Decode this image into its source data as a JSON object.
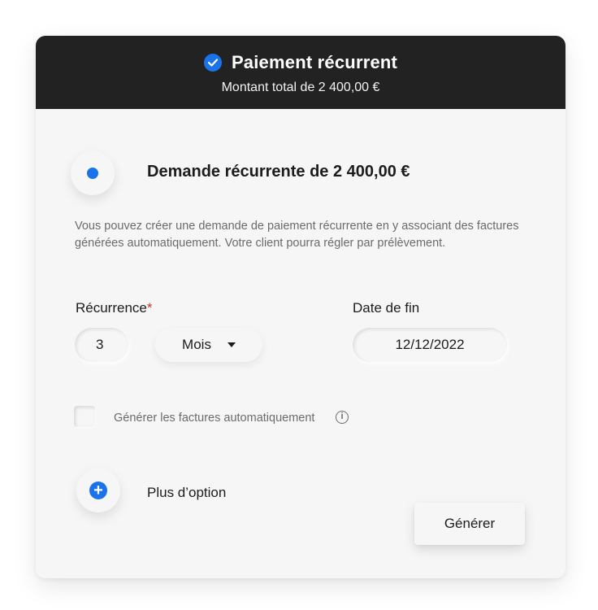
{
  "header": {
    "title": "Paiement récurrent",
    "subtitle": "Montant total de 2 400,00 €",
    "icon": "check-circle-icon"
  },
  "option": {
    "title": "Demande récurrente de 2 400,00 €",
    "selected": true,
    "description": "Vous pouvez créer une demande de paiement récurrente en y associant des factures générées automatiquement. Votre client pourra régler par prélèvement."
  },
  "recurrence": {
    "label": "Récurrence",
    "required_mark": "*",
    "count": "3",
    "unit": "Mois"
  },
  "end_date": {
    "label": "Date de fin",
    "value": "12/12/2022"
  },
  "auto_invoices": {
    "label": "Générer les factures automatiquement",
    "checked": false,
    "info_icon": "i"
  },
  "more_options": {
    "label": "Plus d’option",
    "icon": "+"
  },
  "actions": {
    "generate_label": "Générer"
  },
  "colors": {
    "accent": "#1a73e8",
    "header_bg": "#222222",
    "card_bg": "#f6f6f6",
    "required": "#c0392b"
  }
}
